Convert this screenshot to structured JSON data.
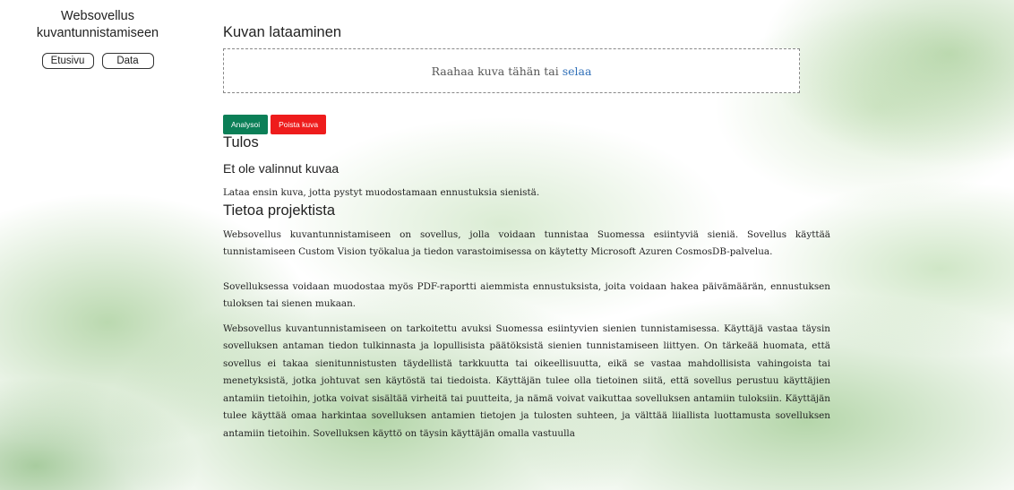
{
  "sidebar": {
    "title_line1": "Websovellus",
    "title_line2": "kuvantunnistamiseen",
    "nav": {
      "home": "Etusivu",
      "data": "Data"
    }
  },
  "upload": {
    "heading": "Kuvan lataaminen",
    "drop_text": "Raahaa kuva tähän tai",
    "browse_link": "selaa"
  },
  "actions": {
    "analyze": "Analysoi",
    "delete": "Poista kuva"
  },
  "result": {
    "heading": "Tulos",
    "status": "Et ole valinnut kuvaa",
    "message": "Lataa ensin kuva, jotta pystyt muodostamaan ennustuksia sienistä."
  },
  "about": {
    "heading": "Tietoa projektista",
    "paragraph1": "Websovellus kuvantunnistamiseen on sovellus, jolla voidaan tunnistaa Suomessa esiintyviä sieniä. Sovellus käyttää tunnistamiseen Custom Vision työkalua ja tiedon varastoimisessa on käytetty Microsoft Azuren CosmosDB-palvelua.",
    "paragraph2": "Sovelluksessa voidaan muodostaa myös PDF-raportti aiemmista ennustuksista, joita voidaan hakea päivämäärän, ennustuksen tuloksen tai sienen mukaan.",
    "paragraph3": "Websovellus kuvantunnistamiseen on tarkoitettu avuksi Suomessa esiintyvien sienien tunnistamisessa. Käyttäjä vastaa täysin sovelluksen antaman tiedon tulkinnasta ja lopullisista päätöksistä sienien tunnistamiseen liittyen. On tärkeää huomata, että sovellus ei takaa sienitunnistusten täydellistä tarkkuutta tai oikeellisuutta, eikä se vastaa mahdollisista vahingoista tai menetyksistä, jotka johtuvat sen käytöstä tai tiedoista. Käyttäjän tulee olla tietoinen siitä, että sovellus perustuu käyttäjien antamiin tietoihin, jotka voivat sisältää virheitä tai puutteita, ja nämä voivat vaikuttaa sovelluksen antamiin tuloksiin. Käyttäjän tulee käyttää omaa harkintaa sovelluksen antamien tietojen ja tulosten suhteen, ja välttää liiallista luottamusta sovelluksen antamiin tietoihin. Sovelluksen käyttö on täysin käyttäjän omalla vastuulla"
  },
  "colors": {
    "analyze_button": "#0b7f57",
    "delete_button": "#ee1c1c",
    "link": "#2f6fb8",
    "background_wash": "#8cbe78"
  }
}
